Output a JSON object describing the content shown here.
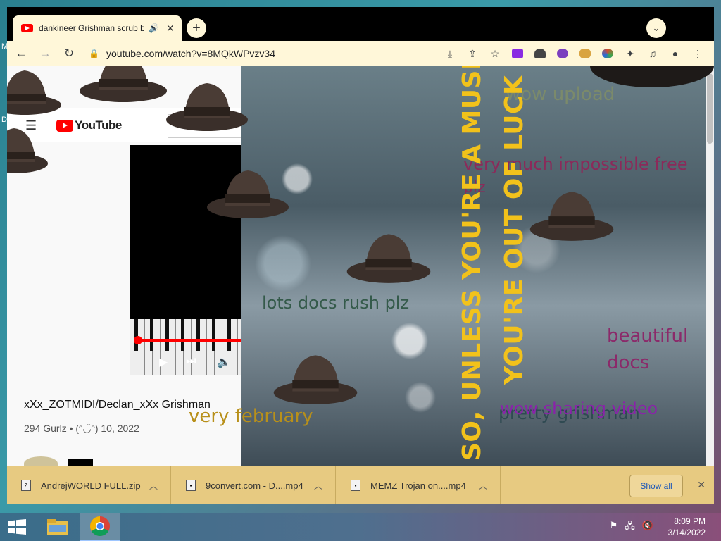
{
  "browser": {
    "tab": {
      "title": "dankineer Grishman scrub b",
      "close": "✕"
    },
    "address": "youtube.com/watch?v=8MQkWPvzv34",
    "extension_colors": [
      "#8a2be2",
      "#444444",
      "#7b3fbf",
      "#d9a441",
      "#d94a2a",
      "#5f6368"
    ]
  },
  "youtube": {
    "logo_text": "YouTube",
    "video_title": "xXx_ZOTMIDI/Declan_xXx Grishman",
    "video_meta": "294 Gurlz • (ᵔ◡̈ᵔ) 10, 2022"
  },
  "overlay": {
    "wow_upload": "wow upload",
    "impossible": "very much impossible free",
    "plz": "plz",
    "lots_docs": "lots docs rush plz",
    "beautiful": "beautiful",
    "docs": "docs",
    "february": "very february",
    "grishman": "pretty grishman",
    "sharing": "wow sharing video",
    "vertical_1": "SO, UNLESS YOU'RE A MUSHRO",
    "vertical_2": "YOU'RE OUT OF LUCK"
  },
  "downloads": {
    "items": [
      {
        "name": "AndrejWORLD FULL.zip"
      },
      {
        "name": "9convert.com - D....mp4"
      },
      {
        "name": "MEMZ Trojan on....mp4"
      }
    ],
    "show_all": "Show all"
  },
  "taskbar": {
    "time": "8:09 PM",
    "date": "3/14/2022"
  }
}
